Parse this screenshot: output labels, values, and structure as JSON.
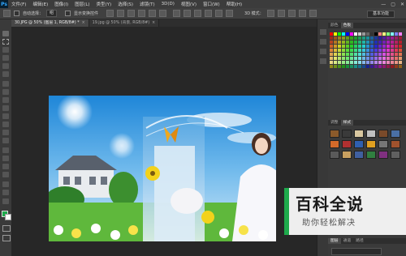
{
  "menu": {
    "logo": "Ps",
    "items": [
      "文件(F)",
      "编辑(E)",
      "图像(I)",
      "图层(L)",
      "类型(Y)",
      "选择(S)",
      "滤镜(T)",
      "3D(D)",
      "视图(V)",
      "窗口(W)",
      "帮助(H)"
    ],
    "window_controls": [
      "—",
      "▢",
      "✕"
    ]
  },
  "options": {
    "auto_select_label": "自动选择：",
    "auto_select_value": "组",
    "show_transform_label": "显示变换控件",
    "mode_label": "3D 模式：",
    "workspace": "基本功能"
  },
  "tabs": [
    {
      "label": "30.JPG @ 50% (图层 1, RGB/8#) *",
      "close": "×",
      "active": true
    },
    {
      "label": "19.jpg @ 50% (背景, RGB/8#)",
      "close": "×",
      "active": false
    }
  ],
  "swatches_panel": {
    "tabs": [
      "颜色",
      "色板"
    ]
  },
  "styles_panel": {
    "tabs": [
      "调整",
      "样式"
    ]
  },
  "layers_panel": {
    "tabs": [
      "图层",
      "通道",
      "路径"
    ]
  },
  "watermark": {
    "title": "百科全说",
    "subtitle": "助你轻松解决"
  },
  "colors": {
    "fg": "#1eaa4c",
    "bg": "#ffffff",
    "ps_blue": "#31a8ff"
  }
}
